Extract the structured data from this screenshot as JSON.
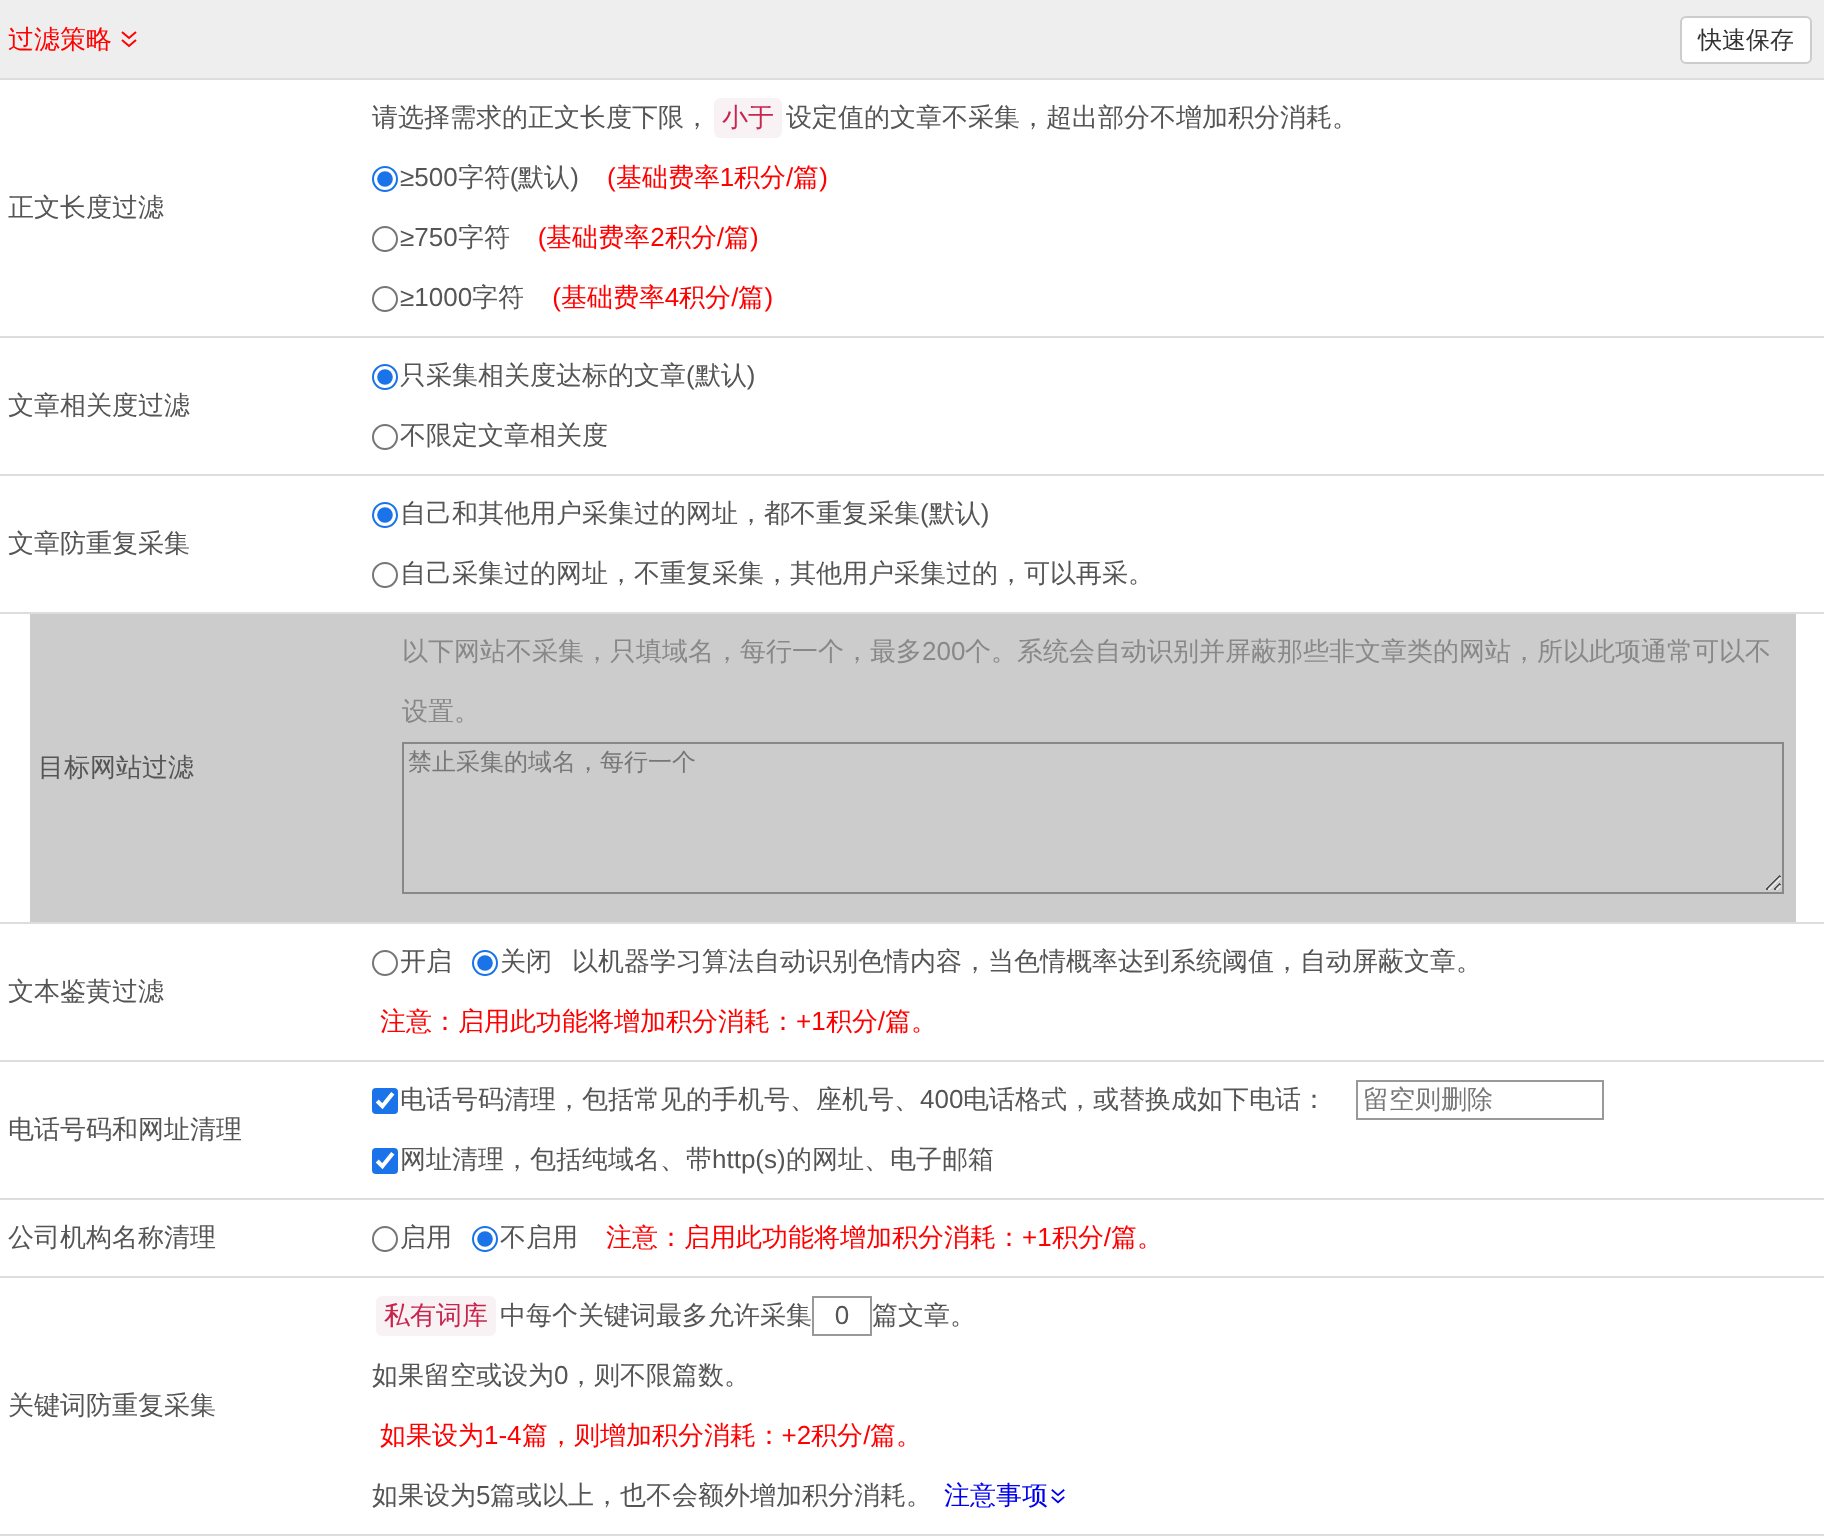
{
  "header": {
    "title": "过滤策略",
    "button": "快速保存"
  },
  "sections": [
    {
      "label": "正文长度过滤",
      "highlighted": false,
      "lines": [
        [
          {
            "kind": "text",
            "text": "请选择需求的正文长度下限，"
          },
          {
            "kind": "tag",
            "text": "小于"
          },
          {
            "kind": "text",
            "text": "设定值的文章不采集，超出部分不增加积分消耗。"
          }
        ],
        [
          {
            "kind": "radio",
            "label": "≥500字符(默认)",
            "selected": true
          },
          {
            "kind": "note",
            "text": "(基础费率1积分/篇)"
          }
        ],
        [
          {
            "kind": "radio",
            "label": "≥750字符",
            "selected": false
          },
          {
            "kind": "note",
            "text": "(基础费率2积分/篇)"
          }
        ],
        [
          {
            "kind": "radio",
            "label": "≥1000字符",
            "selected": false
          },
          {
            "kind": "note",
            "text": "(基础费率4积分/篇)"
          }
        ]
      ]
    },
    {
      "label": "文章相关度过滤",
      "highlighted": false,
      "lines": [
        [
          {
            "kind": "radio",
            "label": "只采集相关度达标的文章(默认)",
            "selected": true
          }
        ],
        [
          {
            "kind": "radio",
            "label": "不限定文章相关度",
            "selected": false
          }
        ]
      ]
    },
    {
      "label": "文章防重复采集",
      "highlighted": false,
      "lines": [
        [
          {
            "kind": "radio",
            "label": "自己和其他用户采集过的网址，都不重复采集(默认)",
            "selected": true
          }
        ],
        [
          {
            "kind": "radio",
            "label": "自己采集过的网址，不重复采集，其他用户采集过的，可以再采。",
            "selected": false
          }
        ]
      ]
    },
    {
      "label": "目标网站过滤",
      "highlighted": true,
      "lines": [
        [
          {
            "kind": "muted",
            "text": "以下网站不采集，只填域名，每行一个，最多200个。系统会自动识别并屏蔽那些非文章类的网站，所以此项通常可以不设置。"
          }
        ],
        [
          {
            "kind": "textarea",
            "placeholder": "禁止采集的域名，每行一个"
          }
        ]
      ]
    },
    {
      "label": "文本鉴黄过滤",
      "highlighted": false,
      "lines": [
        [
          {
            "kind": "radio",
            "label": "开启",
            "selected": false
          },
          {
            "kind": "radio",
            "label": "关闭",
            "selected": true
          },
          {
            "kind": "text",
            "text": "以机器学习算法自动识别色情内容，当色情概率达到系统阈值，自动屏蔽文章。"
          }
        ],
        [
          {
            "kind": "note",
            "text": "注意：启用此功能将增加积分消耗：+1积分/篇。"
          }
        ]
      ]
    },
    {
      "label": "电话号码和网址清理",
      "highlighted": false,
      "lines": [
        [
          {
            "kind": "checkbox",
            "label": "电话号码清理，包括常见的手机号、座机号、400电话格式，或替换成如下电话：",
            "checked": true
          },
          {
            "kind": "input",
            "placeholder": "留空则删除"
          }
        ],
        [
          {
            "kind": "checkbox",
            "label": "网址清理，包括纯域名、带http(s)的网址、电子邮箱",
            "checked": true
          }
        ]
      ]
    },
    {
      "label": "公司机构名称清理",
      "highlighted": false,
      "lines": [
        [
          {
            "kind": "radio",
            "label": "启用",
            "selected": false
          },
          {
            "kind": "radio",
            "label": "不启用",
            "selected": true
          },
          {
            "kind": "note",
            "text": "注意：启用此功能将增加积分消耗：+1积分/篇。"
          }
        ]
      ]
    },
    {
      "label": "关键词防重复采集",
      "highlighted": false,
      "lines": [
        [
          {
            "kind": "tag",
            "text": "私有词库"
          },
          {
            "kind": "text",
            "text": "中每个关键词最多允许采集"
          },
          {
            "kind": "number",
            "value": "0"
          },
          {
            "kind": "text",
            "text": "篇文章。"
          }
        ],
        [
          {
            "kind": "text",
            "text": "如果留空或设为0，则不限篇数。"
          }
        ],
        [
          {
            "kind": "note",
            "text": "如果设为1-4篇，则增加积分消耗：+2积分/篇。"
          }
        ],
        [
          {
            "kind": "text",
            "text": "如果设为5篇或以上，也不会额外增加积分消耗。"
          },
          {
            "kind": "link",
            "text": "注意事项"
          }
        ]
      ]
    }
  ]
}
